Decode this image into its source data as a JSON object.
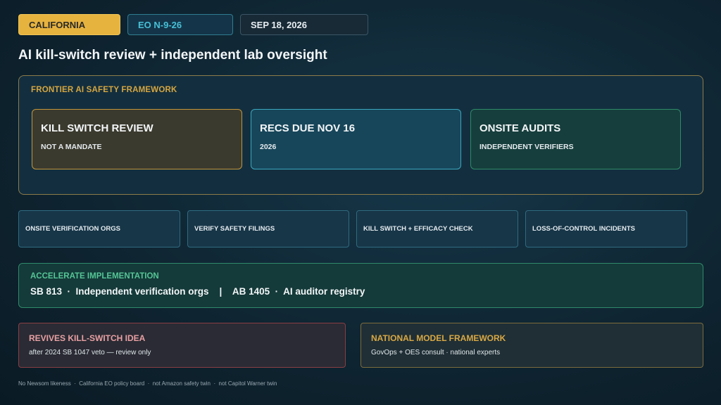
{
  "chips": {
    "state": "CALIFORNIA",
    "order": "EO N-9-26",
    "date": "SEP 18, 2026"
  },
  "title": "AI kill-switch review + independent lab oversight",
  "framework": {
    "label": "FRONTIER AI SAFETY FRAMEWORK",
    "cards": [
      {
        "title": "KILL SWITCH REVIEW",
        "subtitle": "NOT A MANDATE"
      },
      {
        "title": "RECS DUE NOV 16",
        "subtitle": "2026"
      },
      {
        "title": "ONSITE AUDITS",
        "subtitle": "INDEPENDENT VERIFIERS"
      }
    ]
  },
  "pills": [
    "ONSITE VERIFICATION ORGS",
    "VERIFY SAFETY FILINGS",
    "KILL SWITCH + EFFICACY CHECK",
    "LOSS-OF-CONTROL INCIDENTS"
  ],
  "accelerate": {
    "label": "ACCELERATE IMPLEMENTATION",
    "line": "SB 813  ·  Independent verification orgs    |    AB 1405  ·  AI auditor registry"
  },
  "panels": {
    "left": {
      "title": "REVIVES KILL-SWITCH IDEA",
      "text": "after 2024 SB 1047 veto — review only"
    },
    "right": {
      "title": "NATIONAL MODEL FRAMEWORK",
      "text": "GovOps + OES consult  ·  national experts"
    }
  },
  "footer": "No Newsom likeness  ·  California EO policy board  ·  not Amazon safety twin  ·  not Capitol Warner twin"
}
